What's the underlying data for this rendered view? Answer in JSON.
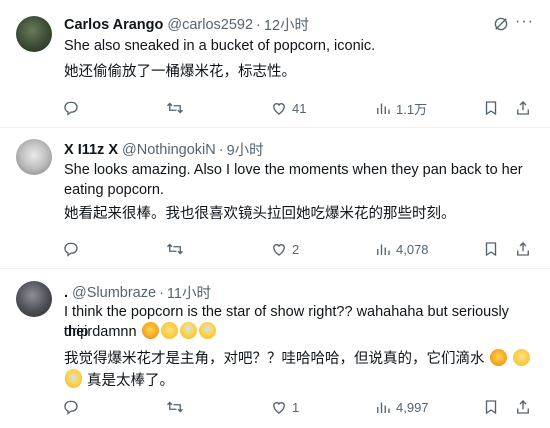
{
  "tweets": [
    {
      "name": "Carlos Arango",
      "handle": "@carlos2592",
      "time": "12小时",
      "text_original": "She also sneaked in a bucket of popcorn, iconic.",
      "text_translated": "她还偷偷放了一桶爆米花，标志性。",
      "replies": "",
      "retweets": "",
      "likes": "41",
      "views": "1.1万"
    },
    {
      "name": "X I11z X",
      "handle": "@NothingokiN",
      "time": "9小时",
      "text_original_1": "She looks amazing. Also I love the moments when they pan back to her",
      "text_original_2": "eating popcorn.",
      "text_translated": "她看起来很棒。我也很喜欢镜头拉回她吃爆米花的那些时刻。",
      "replies": "",
      "retweets": "",
      "likes": "2",
      "views": "4,078"
    },
    {
      "name": ".",
      "handle": "@Slumbraze",
      "time": "11小时",
      "text_original_1": "I think the popcorn is the star of show right?? wahahaha but seriously their",
      "text_original_2": "drip damnn",
      "text_translated_1": "我觉得爆米花才是主角，对吧？？哇哈哈哈，但说真的，它们滴水",
      "text_translated_2": "真是太棒了。",
      "replies": "",
      "retweets": "",
      "likes": "1",
      "views": "4,997"
    }
  ],
  "icons": {
    "reply": "reply-icon",
    "retweet": "retweet-icon",
    "like": "heart-icon",
    "views": "views-icon",
    "bookmark": "bookmark-icon",
    "share": "share-icon",
    "grok": "grok-icon",
    "more": "more-icon",
    "emoji_hot": "hot-face-emoji",
    "emoji_smirk": "smirk-emoji",
    "emoji_scream": "scream-emoji"
  },
  "colors": {
    "text": "#0f1419",
    "secondary": "#536471",
    "divider": "#eff3f4"
  }
}
